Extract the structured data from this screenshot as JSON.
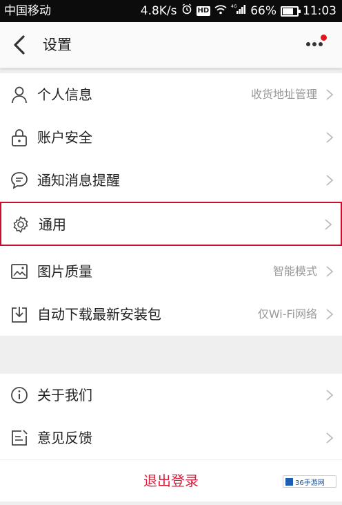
{
  "status_bar": {
    "carrier": "中国移动",
    "speed": "4.8K/s",
    "hd": "HD",
    "network": "4G",
    "battery": "66%",
    "time": "11:03"
  },
  "header": {
    "title": "设置"
  },
  "group1": [
    {
      "label": "个人信息",
      "value": "收货地址管理",
      "icon": "person-icon"
    },
    {
      "label": "账户安全",
      "value": "",
      "icon": "lock-icon"
    },
    {
      "label": "通知消息提醒",
      "value": "",
      "icon": "message-icon"
    },
    {
      "label": "通用",
      "value": "",
      "icon": "gear-icon"
    },
    {
      "label": "图片质量",
      "value": "智能模式",
      "icon": "image-icon"
    },
    {
      "label": "自动下载最新安装包",
      "value": "仅Wi-Fi网络",
      "icon": "download-icon"
    }
  ],
  "group2": [
    {
      "label": "关于我们",
      "value": "",
      "icon": "info-icon"
    },
    {
      "label": "意见反馈",
      "value": "",
      "icon": "feedback-icon"
    }
  ],
  "logout": {
    "label": "退出登录"
  },
  "watermark": {
    "text": "36手游网"
  },
  "colors": {
    "accent": "#d81e3c",
    "highlight_border": "#c8102e"
  }
}
